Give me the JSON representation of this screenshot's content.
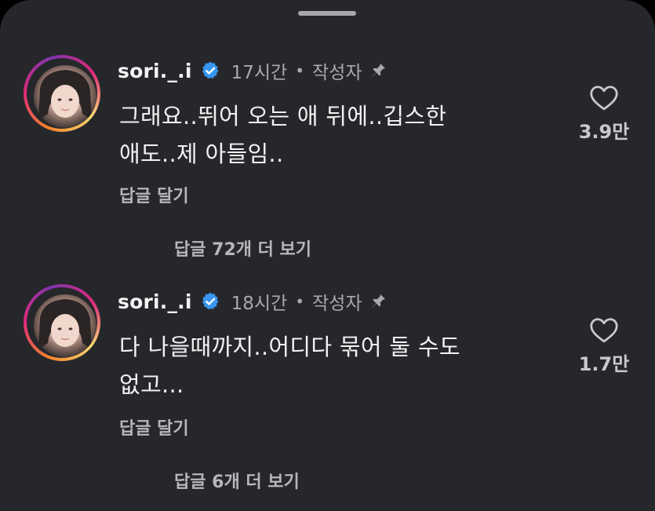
{
  "comments": [
    {
      "username": "sori._.i",
      "time": "17시간",
      "separator": "•",
      "author_label": "작성자",
      "text_lines": [
        "그래요..뛰어 오는 애 뒤에..깁스한",
        "애도..제 아들임.."
      ],
      "reply_label": "답글 달기",
      "likes": "3.9만",
      "more_replies": "답글 72개 더 보기"
    },
    {
      "username": "sori._.i",
      "time": "18시간",
      "separator": "•",
      "author_label": "작성자",
      "text_lines": [
        "다 나을때까지..어디다 묶어 둘 수도",
        "없고..."
      ],
      "reply_label": "답글 달기",
      "likes": "1.7만",
      "more_replies": "답글 6개 더 보기"
    }
  ],
  "icons": {
    "verified": "verified-badge-icon",
    "pin": "pin-icon",
    "like": "heart-outline-icon"
  },
  "colors": {
    "background": "#26272b",
    "verified": "#3897f0",
    "text": "#f2f2f2",
    "muted": "#a9aaae"
  }
}
